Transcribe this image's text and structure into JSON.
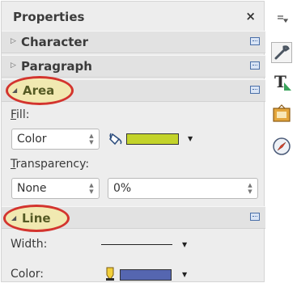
{
  "panel": {
    "title": "Properties",
    "close_glyph": "×"
  },
  "sections": {
    "character": {
      "label": "Character",
      "state": "collapsed"
    },
    "paragraph": {
      "label": "Paragraph",
      "state": "collapsed"
    },
    "area": {
      "label": "Area",
      "state": "expanded",
      "fill_label_mnemonic": "F",
      "fill_label_rest": "ill:",
      "fill_type": "Color",
      "fill_color": "#c3d32a",
      "transparency_label_mnemonic": "T",
      "transparency_label_rest": "ransparency:",
      "transparency_mode": "None",
      "transparency_value": "0%"
    },
    "line": {
      "label": "Line",
      "state": "expanded",
      "width_label": "Width:",
      "color_label": "Color:",
      "line_color": "#5566b0"
    }
  },
  "deck": {
    "menu_icon": "deck-menu-icon",
    "tabs": [
      "properties-wrench-icon",
      "styles-T-icon",
      "gallery-icon",
      "navigator-compass-icon"
    ]
  },
  "colors": {
    "highlight_ring": "#d3342e",
    "highlight_fill": "#f5eba0",
    "accent_blue": "#4a6fa8"
  }
}
